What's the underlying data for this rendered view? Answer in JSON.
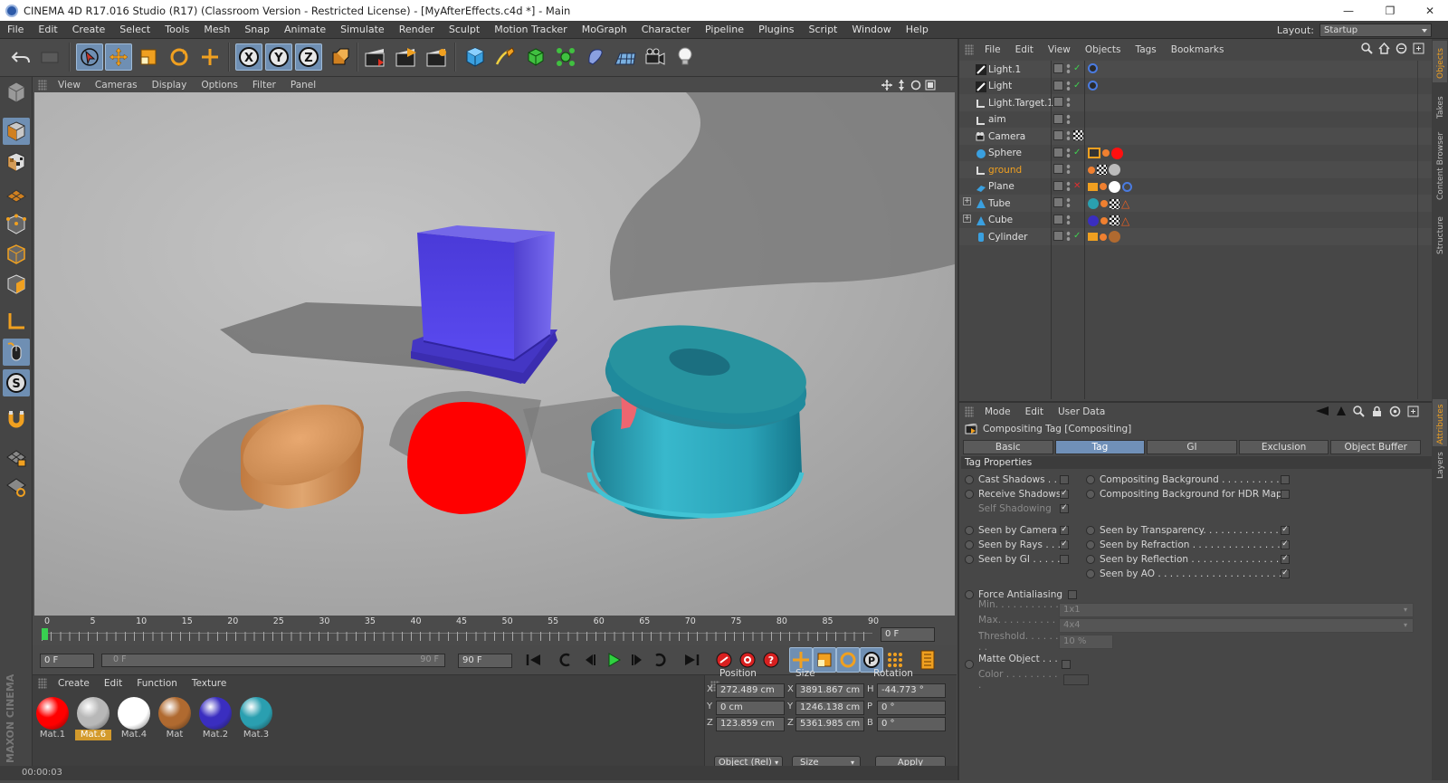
{
  "window": {
    "title": "CINEMA 4D R17.016 Studio (R17) (Classroom Version - Restricted License) - [MyAfterEffects.c4d *] - Main",
    "minimize": "—",
    "maximize": "❐",
    "close": "✕"
  },
  "menubar": {
    "items": [
      "File",
      "Edit",
      "Create",
      "Select",
      "Tools",
      "Mesh",
      "Snap",
      "Animate",
      "Simulate",
      "Render",
      "Sculpt",
      "Motion Tracker",
      "MoGraph",
      "Character",
      "Pipeline",
      "Plugins",
      "Script",
      "Window",
      "Help"
    ],
    "layout_label": "Layout:",
    "layout_value": "Startup"
  },
  "toolbar": {
    "axis_x": "X",
    "axis_y": "Y",
    "axis_z": "Z"
  },
  "viewport": {
    "menu": [
      "View",
      "Cameras",
      "Display",
      "Options",
      "Filter",
      "Panel"
    ]
  },
  "timeline": {
    "ticks": [
      "0",
      "5",
      "10",
      "15",
      "20",
      "25",
      "30",
      "35",
      "40",
      "45",
      "50",
      "55",
      "60",
      "65",
      "70",
      "75",
      "80",
      "85",
      "90"
    ],
    "current_frame": "0 F",
    "start_field": "0 F",
    "slider_start": "0 F",
    "slider_end": "90 F",
    "end_field": "90 F"
  },
  "materials": {
    "menu": [
      "Create",
      "Edit",
      "Function",
      "Texture"
    ],
    "items": [
      {
        "label": "Mat.1",
        "color": "#ff0000"
      },
      {
        "label": "Mat.6",
        "color": "#b8b8b8"
      },
      {
        "label": "Mat.4",
        "color": "#ffffff"
      },
      {
        "label": "Mat",
        "color": "#b06a30"
      },
      {
        "label": "Mat.2",
        "color": "#3a2ec0"
      },
      {
        "label": "Mat.3",
        "color": "#2a9fb0"
      }
    ],
    "selected": "Mat.6"
  },
  "coordinates": {
    "headers": [
      "Position",
      "Size",
      "Rotation"
    ],
    "rows": [
      {
        "axis": "X",
        "pos": "272.489 cm",
        "saxis": "X",
        "size": "3891.867 cm",
        "raxis": "H",
        "rot": "-44.773 °"
      },
      {
        "axis": "Y",
        "pos": "0 cm",
        "saxis": "Y",
        "size": "1246.138 cm",
        "raxis": "P",
        "rot": "0 °"
      },
      {
        "axis": "Z",
        "pos": "123.859 cm",
        "saxis": "Z",
        "size": "5361.985 cm",
        "raxis": "B",
        "rot": "0 °"
      }
    ],
    "mode": "Object (Rel)",
    "size_mode": "Size",
    "apply": "Apply"
  },
  "status": {
    "time": "00:00:03"
  },
  "objects": {
    "menu": [
      "File",
      "Edit",
      "View",
      "Objects",
      "Tags",
      "Bookmarks"
    ],
    "items": [
      {
        "name": "Light.1",
        "icon": "light-icon"
      },
      {
        "name": "Light",
        "icon": "light-icon"
      },
      {
        "name": "Light.Target.1",
        "icon": "null-icon"
      },
      {
        "name": "aim",
        "icon": "null-icon"
      },
      {
        "name": "Camera",
        "icon": "camera-icon"
      },
      {
        "name": "Sphere",
        "icon": "sphere-icon"
      },
      {
        "name": "ground",
        "icon": "null-icon"
      },
      {
        "name": "Plane",
        "icon": "plane-icon"
      },
      {
        "name": "Tube",
        "icon": "tube-icon"
      },
      {
        "name": "Cube",
        "icon": "cube-icon"
      },
      {
        "name": "Cylinder",
        "icon": "cylinder-icon"
      }
    ],
    "selected": "ground"
  },
  "attributes": {
    "menu": [
      "Mode",
      "Edit",
      "User Data"
    ],
    "title": "Compositing Tag [Compositing]",
    "tabs": [
      "Basic",
      "Tag",
      "GI",
      "Exclusion",
      "Object Buffer"
    ],
    "active_tab": "Tag",
    "section": "Tag Properties",
    "left": [
      {
        "label": "Cast Shadows . .",
        "checked": ""
      },
      {
        "label": "Receive Shadows",
        "checked": "✓"
      },
      {
        "label": "Self Shadowing",
        "checked": "✓"
      },
      {
        "label": "Seen by Camera",
        "checked": "✓"
      },
      {
        "label": "Seen by Rays . . .",
        "checked": "✓"
      },
      {
        "label": "Seen by GI . . . . .",
        "checked": ""
      }
    ],
    "right": [
      {
        "label": "Compositing Background . . . . . . . . . . . .",
        "checked": ""
      },
      {
        "label": "Compositing Background for HDR Maps",
        "checked": ""
      },
      {
        "label": "Seen by Transparency. . . . . . . . . . . . . . . . .",
        "checked": "✓"
      },
      {
        "label": "Seen by Refraction . . . . . . . . . . . . . . . . . . .",
        "checked": "✓"
      },
      {
        "label": "Seen by Reflection . . . . . . . . . . . . . . . . . . .",
        "checked": "✓"
      },
      {
        "label": "Seen by AO . . . . . . . . . . . . . . . . . . . . . . . . .",
        "checked": "✓"
      }
    ],
    "force_aa": "Force Antialiasing",
    "min_label": "Min. . . . . . . . . . . .",
    "min_value": "1x1",
    "max_label": "Max. . . . . . . . . . . .",
    "max_value": "4x4",
    "threshold_label": "Threshold. . . . . . . .",
    "threshold_value": "10 %",
    "matte_label": "Matte Object . . . .",
    "color_label": "Color . . . . . . . . . ."
  },
  "sidetabs": [
    "Objects",
    "Takes",
    "Content Browser",
    "Structure",
    "Attributes",
    "Layers"
  ],
  "brand": "MAXON CINEMA 4D"
}
